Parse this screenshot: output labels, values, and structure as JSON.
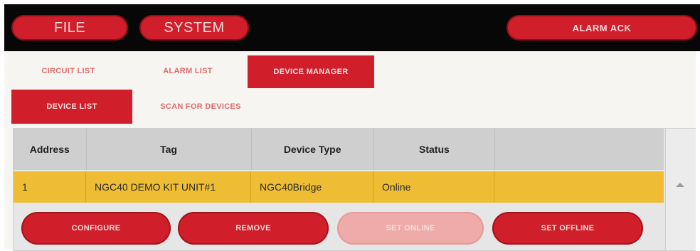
{
  "topbar": {
    "file_label": "FILE",
    "system_label": "SYSTEM",
    "alarm_ack_label": "ALARM ACK"
  },
  "tabs": [
    {
      "label": "CIRCUIT LIST",
      "active": false
    },
    {
      "label": "ALARM LIST",
      "active": false
    },
    {
      "label": "DEVICE MANAGER",
      "active": true
    }
  ],
  "subtabs": [
    {
      "label": "DEVICE LIST",
      "active": true
    },
    {
      "label": "SCAN FOR DEVICES",
      "active": false
    }
  ],
  "table": {
    "columns": [
      "Address",
      "Tag",
      "Device Type",
      "Status"
    ],
    "rows": [
      {
        "address": "1",
        "tag": "NGC40 DEMO KIT UNIT#1",
        "device_type": "NGC40Bridge",
        "status": "Online"
      }
    ]
  },
  "actions": {
    "configure_label": "CONFIGURE",
    "remove_label": "REMOVE",
    "set_online_label": "SET ONLINE",
    "set_offline_label": "SET OFFLINE"
  },
  "colors": {
    "accent": "#d01f2a",
    "selected_row": "#eebd34",
    "topbar": "#070707"
  }
}
